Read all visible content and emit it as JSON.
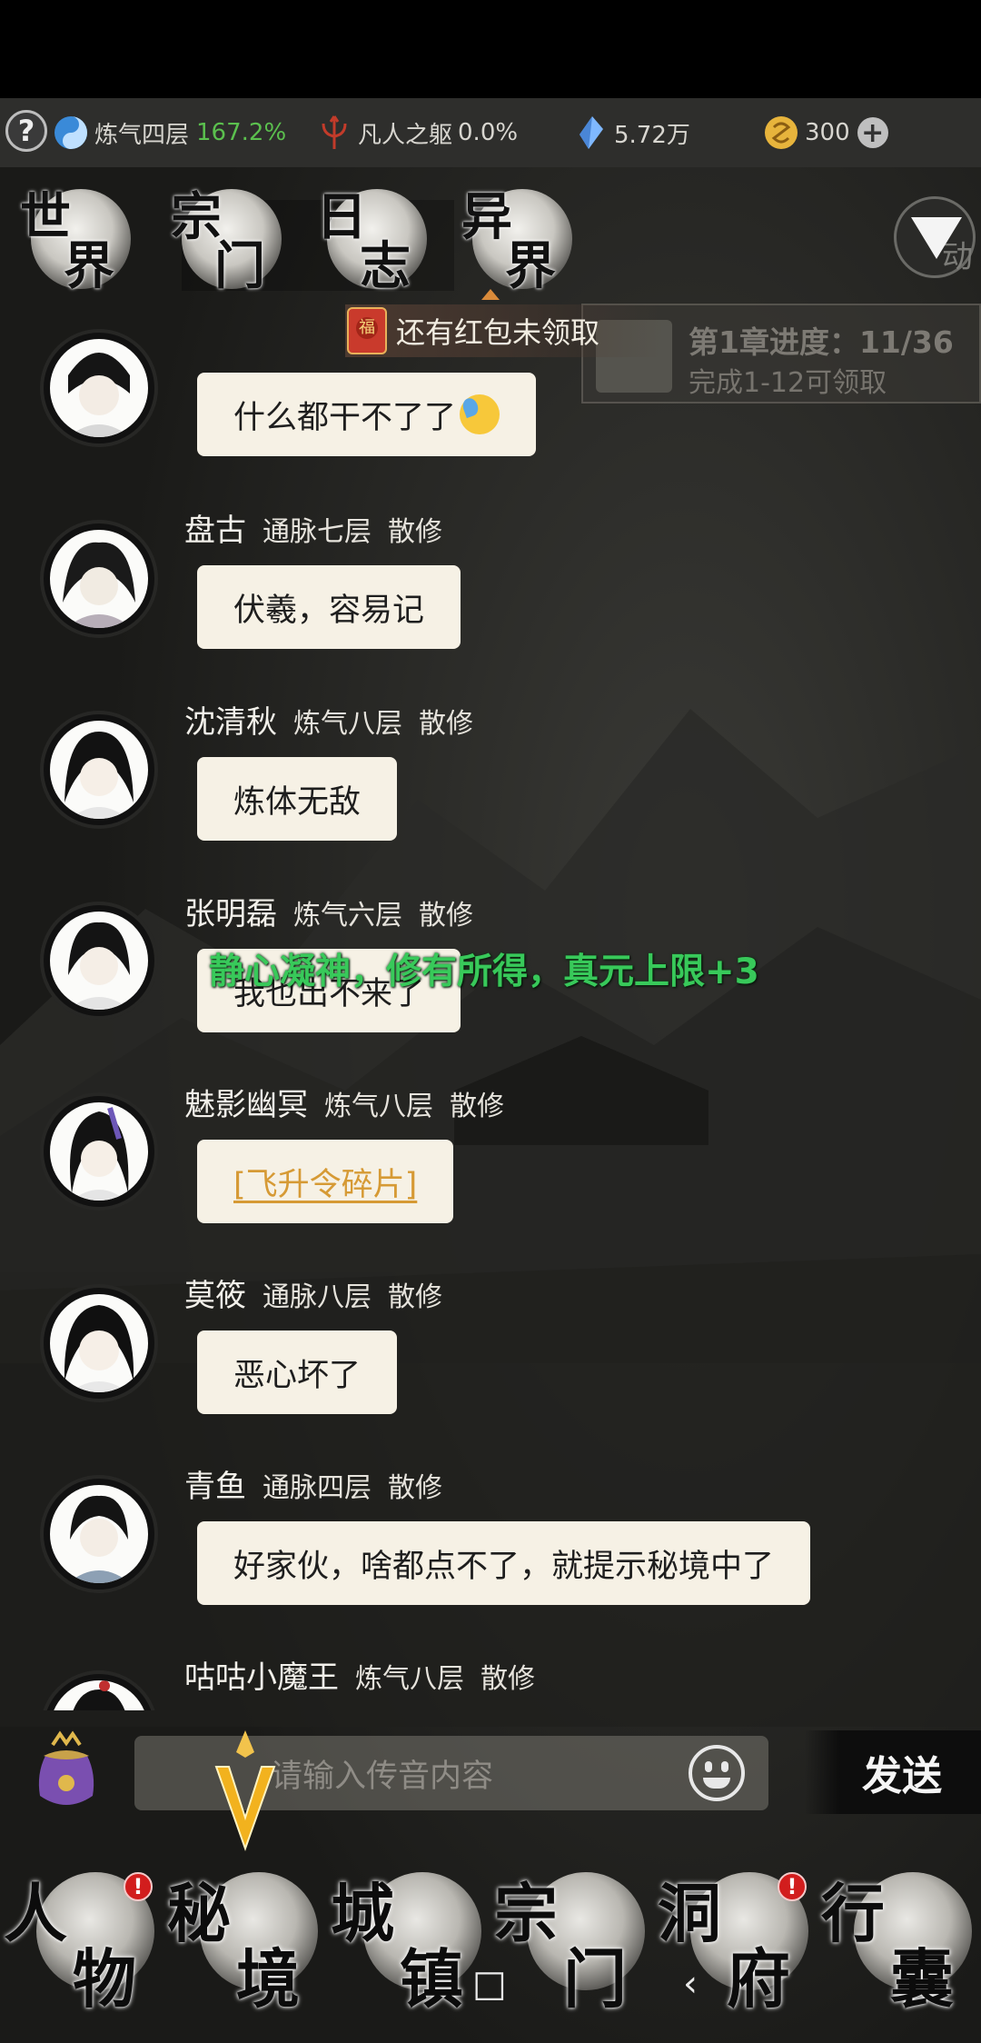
{
  "resources": {
    "help_icon": "?",
    "cultivation_label": "炼气四层",
    "cultivation_percent": "167.2%",
    "body_label": "凡人之躯",
    "body_percent": "0.0%",
    "spirit_stones": "5.72万",
    "currency": "300",
    "plus_icon": "+"
  },
  "channel_tabs": [
    {
      "c1": "世",
      "c2": "界"
    },
    {
      "c1": "宗",
      "c2": "门"
    },
    {
      "c1": "日",
      "c2": "志"
    },
    {
      "c1": "异",
      "c2": "界"
    }
  ],
  "dropdown_text": "动",
  "red_envelope": "还有红包未领取",
  "red_envelope_icon": "福",
  "chapter": {
    "title": "第1章进度：11/36",
    "subtitle": "完成1-12可领取"
  },
  "messages": [
    {
      "name": "",
      "level": "",
      "role": "",
      "text": "什么都干不了了",
      "emoji": "sweat-face"
    },
    {
      "name": "盘古",
      "level": "通脉七层",
      "role": "散修",
      "text": "伏羲，容易记"
    },
    {
      "name": "沈清秋",
      "level": "炼气八层",
      "role": "散修",
      "text": "炼体无敌"
    },
    {
      "name": "张明磊",
      "level": "炼气六层",
      "role": "散修",
      "text": "我也出不来了"
    },
    {
      "name": "魅影幽冥",
      "level": "炼气八层",
      "role": "散修",
      "text": "[飞升令碎片]"
    },
    {
      "name": "莫筱",
      "level": "通脉八层",
      "role": "散修",
      "text": "恶心坏了"
    },
    {
      "name": "青鱼",
      "level": "通脉四层",
      "role": "散修",
      "text": "好家伙，啥都点不了，就提示秘境中了"
    },
    {
      "name": "咕咕小魔王",
      "level": "炼气八层",
      "role": "散修",
      "text": ""
    }
  ],
  "system_float": "静心凝神，修有所得，真元上限+3",
  "input": {
    "placeholder": "请输入传音内容",
    "send_label": "发送"
  },
  "bottom_nav": [
    {
      "c1": "人",
      "c2": "物",
      "badge": "!"
    },
    {
      "c1": "秘",
      "c2": "境",
      "badge": ""
    },
    {
      "c1": "城",
      "c2": "镇",
      "badge": ""
    },
    {
      "c1": "宗",
      "c2": "门",
      "badge": ""
    },
    {
      "c1": "洞",
      "c2": "府",
      "badge": "!"
    },
    {
      "c1": "行",
      "c2": "囊",
      "badge": ""
    }
  ],
  "system_nav": {
    "home": "□",
    "back": "‹"
  },
  "colors": {
    "accent_green": "#5bc04e",
    "float_green": "#38c95a",
    "item_gold": "#d69a35",
    "badge_red": "#d21d1d"
  }
}
